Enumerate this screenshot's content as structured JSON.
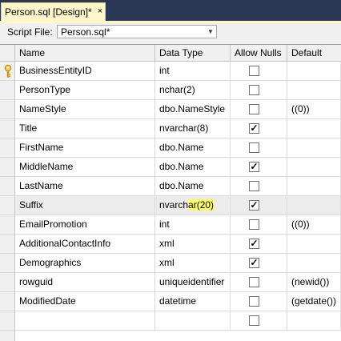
{
  "tab": {
    "title": "Person.sql [Design]*",
    "close_glyph": "×"
  },
  "script_bar": {
    "label": "Script File:",
    "selected": "Person.sql*"
  },
  "grid": {
    "headers": {
      "name": "Name",
      "data_type": "Data Type",
      "allow_nulls": "Allow Nulls",
      "default": "Default"
    },
    "rows": [
      {
        "name": "BusinessEntityID",
        "type_base": "int",
        "type_hl": "",
        "nulls": false,
        "default": "",
        "key": true
      },
      {
        "name": "PersonType",
        "type_base": "nchar(2)",
        "type_hl": "",
        "nulls": false,
        "default": ""
      },
      {
        "name": "NameStyle",
        "type_base": "dbo.NameStyle",
        "type_hl": "",
        "nulls": false,
        "default": "((0))"
      },
      {
        "name": "Title",
        "type_base": "nvarchar(8)",
        "type_hl": "",
        "nulls": true,
        "default": ""
      },
      {
        "name": "FirstName",
        "type_base": "dbo.Name",
        "type_hl": "",
        "nulls": false,
        "default": ""
      },
      {
        "name": "MiddleName",
        "type_base": "dbo.Name",
        "type_hl": "",
        "nulls": true,
        "default": ""
      },
      {
        "name": "LastName",
        "type_base": "dbo.Name",
        "type_hl": "",
        "nulls": false,
        "default": ""
      },
      {
        "name": "Suffix",
        "type_base": "nvarch",
        "type_hl": "ar(20)",
        "nulls": true,
        "default": "",
        "selected": true
      },
      {
        "name": "EmailPromotion",
        "type_base": "int",
        "type_hl": "",
        "nulls": false,
        "default": "((0))"
      },
      {
        "name": "AdditionalContactInfo",
        "type_base": "xml",
        "type_hl": "",
        "nulls": true,
        "default": ""
      },
      {
        "name": "Demographics",
        "type_base": "xml",
        "type_hl": "",
        "nulls": true,
        "default": ""
      },
      {
        "name": "rowguid",
        "type_base": "uniqueidentifier",
        "type_hl": "",
        "nulls": false,
        "default": "(newid())"
      },
      {
        "name": "ModifiedDate",
        "type_base": "datetime",
        "type_hl": "",
        "nulls": false,
        "default": "(getdate())"
      },
      {
        "name": "",
        "type_base": "",
        "type_hl": "",
        "nulls": false,
        "default": ""
      }
    ]
  },
  "icons": {
    "primary_key": "key-icon",
    "dropdown": "chevron-down-icon"
  }
}
